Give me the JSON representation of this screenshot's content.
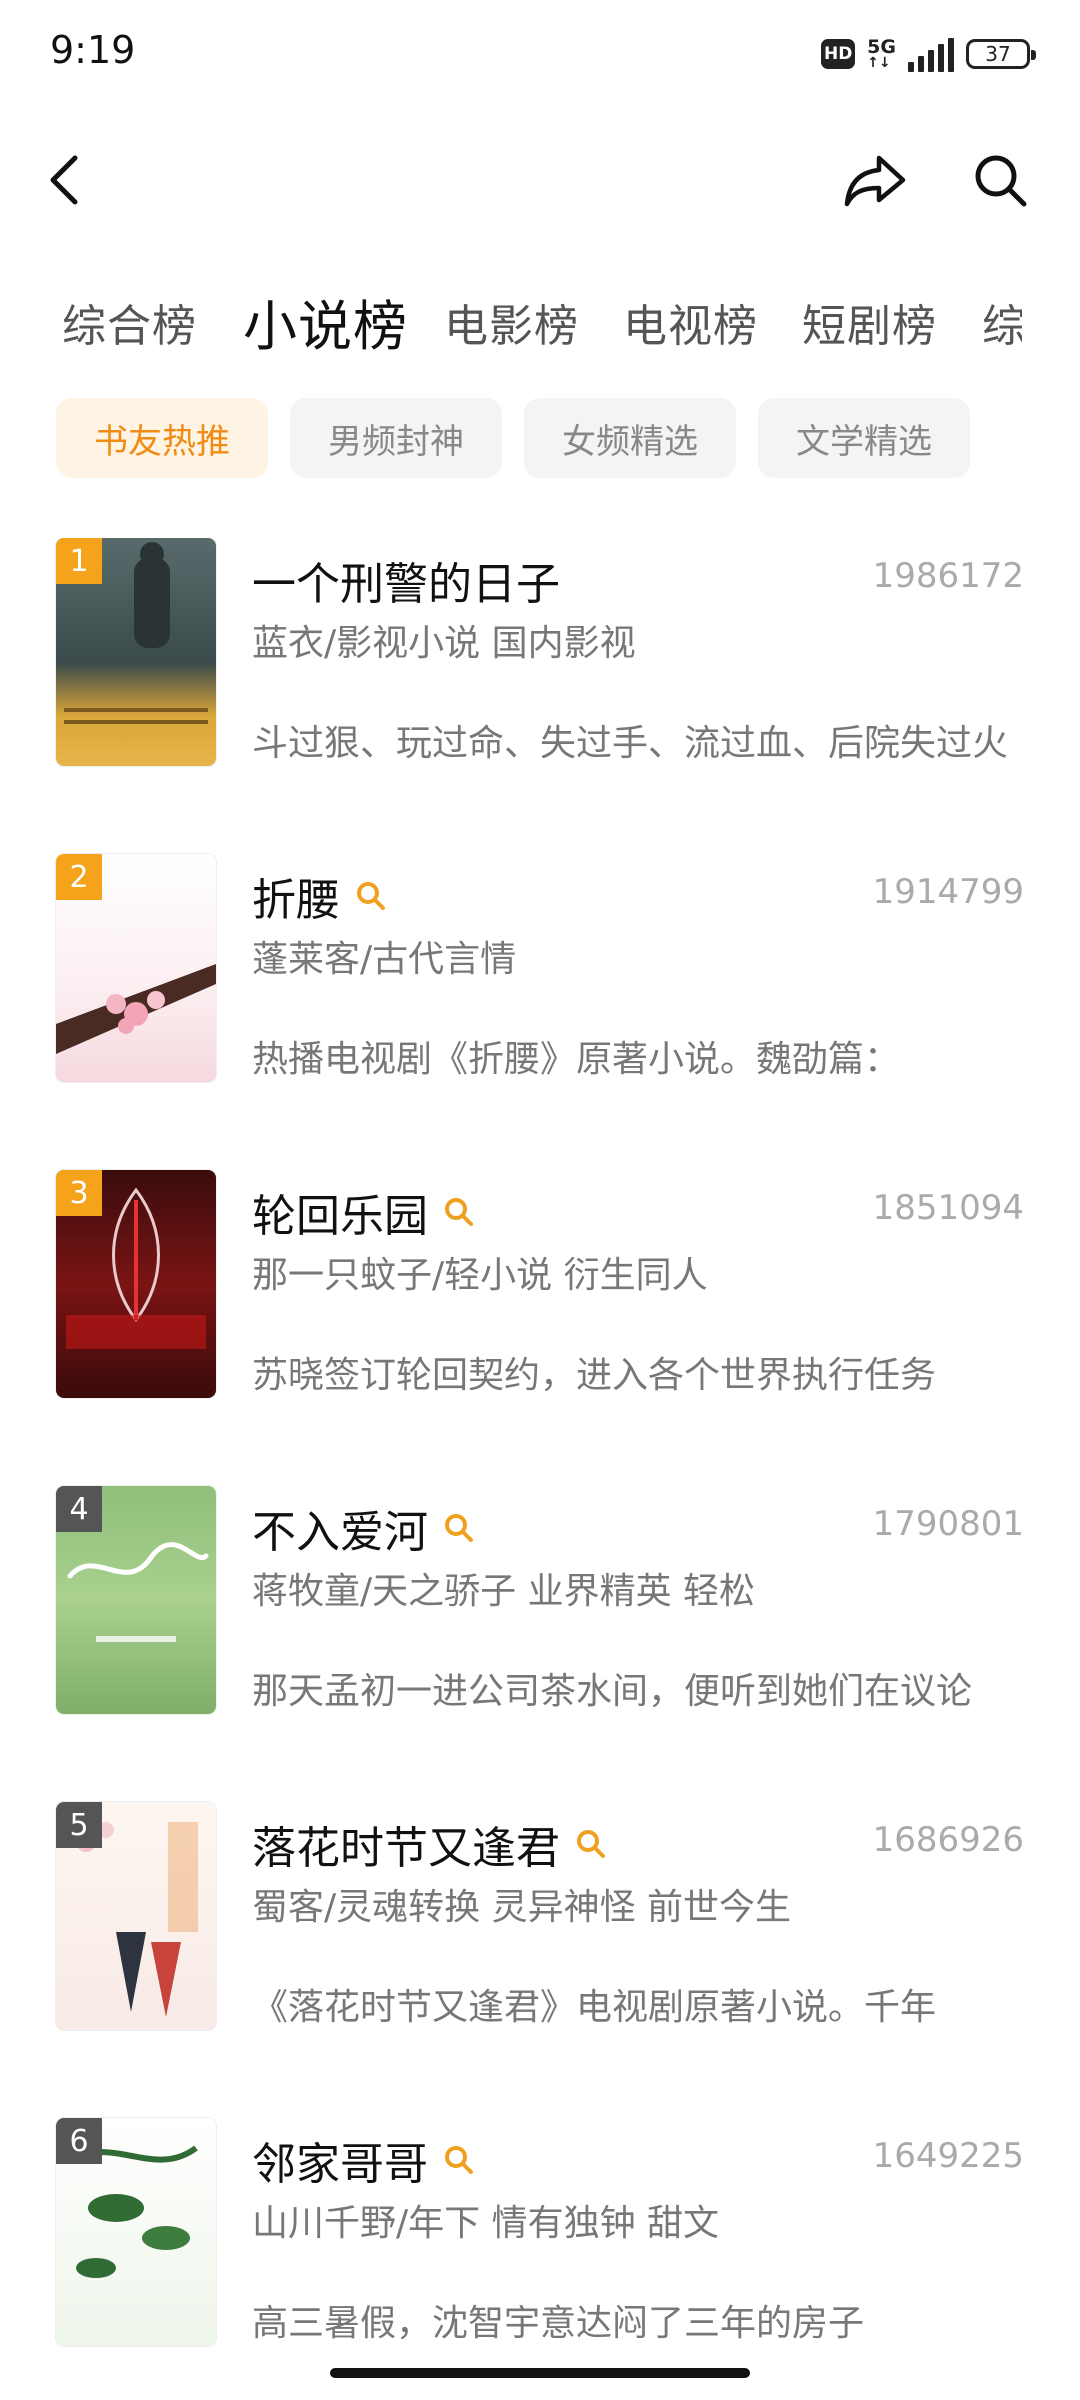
{
  "status_bar": {
    "time": "9:19",
    "hd": "HD",
    "network": "5G",
    "battery": "37"
  },
  "nav": {
    "back_icon": "back-arrow-icon",
    "share_icon": "share-icon",
    "search_icon": "search-icon"
  },
  "rank_tabs": [
    "综合榜",
    "小说榜",
    "电影榜",
    "电视榜",
    "短剧榜",
    "综"
  ],
  "active_rank_tab": "小说榜",
  "filters": [
    "书友热推",
    "男频封神",
    "女频精选",
    "文学精选"
  ],
  "active_filter": "书友热推",
  "colors": {
    "accent": "#f08c14",
    "chip_active_bg": "#fff3e3"
  },
  "books": [
    {
      "rank": "1",
      "title": "一个刑警的日子",
      "count": "1986172",
      "meta": "蓝衣/影视小说 国内影视",
      "desc": "斗过狠、玩过命、失过手、流过血、后院失过火",
      "has_search_icon": false,
      "badge_color": "#f5a31a"
    },
    {
      "rank": "2",
      "title": "折腰",
      "count": "1914799",
      "meta": "蓬莱客/古代言情",
      "desc": "热播电视剧《折腰》原著小说。魏劭篇：",
      "has_search_icon": true,
      "badge_color": "#f5a31a"
    },
    {
      "rank": "3",
      "title": "轮回乐园",
      "count": "1851094",
      "meta": "那一只蚊子/轻小说 衍生同人",
      "desc": "苏晓签订轮回契约，进入各个世界执行任务",
      "has_search_icon": true,
      "badge_color": "#f5a31a"
    },
    {
      "rank": "4",
      "title": "不入爱河",
      "count": "1790801",
      "meta": "蒋牧童/天之骄子 业界精英 轻松",
      "desc": "那天孟初一进公司茶水间，便听到她们在议论",
      "has_search_icon": true,
      "badge_color": "#555555"
    },
    {
      "rank": "5",
      "title": "落花时节又逢君",
      "count": "1686926",
      "meta": "蜀客/灵魂转换 灵异神怪 前世今生",
      "desc": "《落花时节又逢君》电视剧原著小说。千年",
      "has_search_icon": true,
      "badge_color": "#555555"
    },
    {
      "rank": "6",
      "title": "邻家哥哥",
      "count": "1649225",
      "meta": "山川千野/年下 情有独钟 甜文",
      "desc": "高三暑假，沈智宇意达闷了三年的房子",
      "has_search_icon": true,
      "badge_color": "#555555"
    }
  ]
}
